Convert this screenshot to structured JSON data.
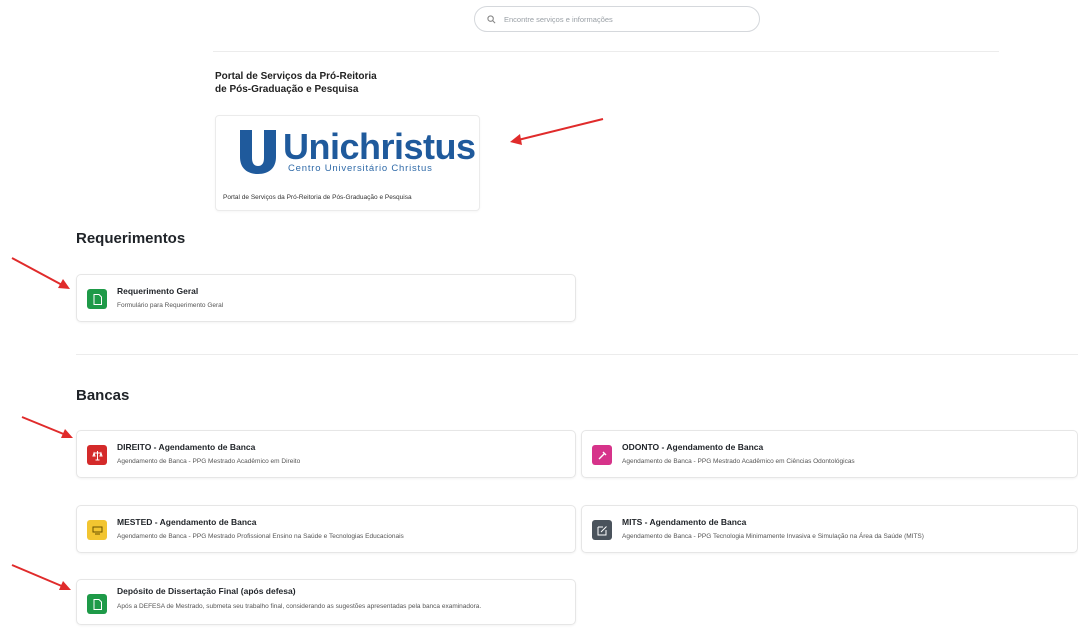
{
  "search": {
    "placeholder": "Encontre serviços e informações"
  },
  "portal": {
    "title_line1": "Portal de Serviços da Pró-Reitoria",
    "title_line2": "de Pós-Graduação e Pesquisa",
    "logo_word": "Unichristus",
    "logo_sub": "Centro Universitário Christus",
    "logo_caption": "Portal de Serviços da Pró-Reitoria de Pós-Graduação e Pesquisa",
    "brand_color": "#1f5a9c"
  },
  "sections": {
    "requerimentos": {
      "title": "Requerimentos",
      "cards": [
        {
          "title": "Requerimento Geral",
          "desc": "Formulário para Requerimento Geral",
          "icon": "document-icon",
          "color": "#1e9a48"
        }
      ]
    },
    "bancas": {
      "title": "Bancas",
      "cards": [
        {
          "title": "DIREITO - Agendamento de Banca",
          "desc": "Agendamento de Banca - PPG Mestrado Acadêmico em Direito",
          "icon": "law-icon",
          "color": "#d42a2a"
        },
        {
          "title": "ODONTO - Agendamento de Banca",
          "desc": "Agendamento de Banca - PPG Mestrado Acadêmico em Ciências Odontológicas",
          "icon": "dental-icon",
          "color": "#d6338a"
        },
        {
          "title": "MESTED - Agendamento de Banca",
          "desc": "Agendamento de Banca - PPG Mestrado Profissional Ensino na Saúde e Tecnologias Educacionais",
          "icon": "education-icon",
          "color": "#f2c531"
        },
        {
          "title": "MITS - Agendamento de Banca",
          "desc": "Agendamento de Banca - PPG Tecnologia Minimamente Invasiva e Simulação na Área da Saúde (MITS)",
          "icon": "edit-icon",
          "color": "#4a535c"
        },
        {
          "title": "Depósito de Dissertação Final (após defesa)",
          "desc": "Após a DEFESA de Mestrado, submeta seu trabalho final, considerando as sugestões apresentadas pela banca examinadora.",
          "icon": "document-icon",
          "color": "#1e9a48"
        }
      ]
    }
  }
}
